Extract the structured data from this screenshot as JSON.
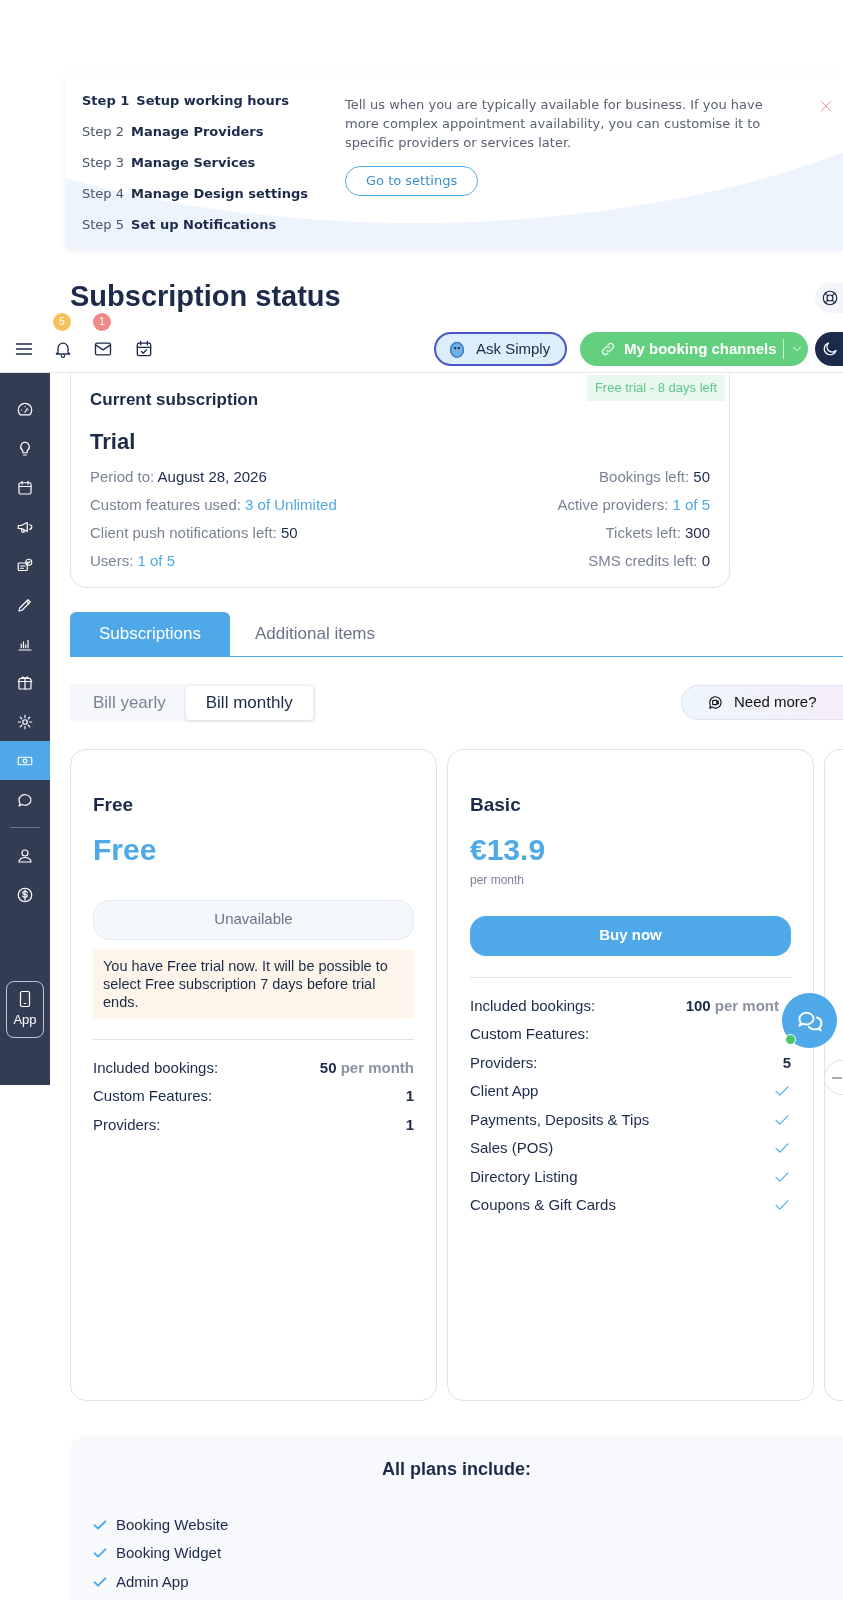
{
  "onboarding": {
    "steps": [
      {
        "label": "Step 1",
        "title": "Setup working hours",
        "selected": true
      },
      {
        "label": "Step 2",
        "title": "Manage Providers",
        "selected": false
      },
      {
        "label": "Step 3",
        "title": "Manage Services",
        "selected": false
      },
      {
        "label": "Step 4",
        "title": "Manage Design settings",
        "selected": false
      },
      {
        "label": "Step 5",
        "title": "Set up Notifications",
        "selected": false
      }
    ],
    "description": "Tell us when you are typically available for business. If you have more complex appointment availability, you can customise it to specific providers or services later.",
    "button": "Go to settings"
  },
  "page_title": "Subscription status",
  "toolbar": {
    "notifications_badge": "5",
    "messages_badge": "1",
    "ask_button": "Ask Simply",
    "channels_button": "My booking channels"
  },
  "sidebar": {
    "items": [
      {
        "kind": "item",
        "selected": false
      },
      {
        "kind": "item",
        "selected": false
      },
      {
        "kind": "item",
        "selected": false
      },
      {
        "kind": "item",
        "selected": false
      },
      {
        "kind": "item",
        "selected": false
      },
      {
        "kind": "item",
        "selected": false
      },
      {
        "kind": "item",
        "selected": false
      },
      {
        "kind": "item",
        "selected": false
      },
      {
        "kind": "item",
        "selected": false
      },
      {
        "kind": "item",
        "selected": true
      },
      {
        "kind": "item",
        "selected": false
      },
      {
        "kind": "divider"
      },
      {
        "kind": "item",
        "selected": false
      },
      {
        "kind": "item",
        "selected": false
      }
    ],
    "app_button": "App"
  },
  "current_subscription": {
    "heading": "Current subscription",
    "badge": "Free trial - 8 days left",
    "plan": "Trial",
    "left": [
      {
        "label": "Period to:",
        "value": "August 28, 2026",
        "kind": "plain"
      },
      {
        "label": "Custom features used:",
        "value": "3 of Unlimited",
        "kind": "link"
      },
      {
        "label": "Client push notifications left:",
        "value": "50",
        "kind": "plain"
      },
      {
        "label": "Users:",
        "value": "1 of 5",
        "kind": "link"
      }
    ],
    "right": [
      {
        "label": "Bookings left:",
        "value": "50",
        "kind": "plain"
      },
      {
        "label": "Active providers:",
        "value": "1 of 5",
        "kind": "link"
      },
      {
        "label": "Tickets left:",
        "value": "300",
        "kind": "plain"
      },
      {
        "label": "SMS credits left:",
        "value": "0",
        "kind": "plain"
      }
    ]
  },
  "tabs": [
    {
      "label": "Subscriptions",
      "selected": true
    },
    {
      "label": "Additional items",
      "selected": false
    }
  ],
  "billing": [
    {
      "label": "Bill yearly",
      "selected": false
    },
    {
      "label": "Bill monthly",
      "selected": true
    }
  ],
  "need_more_button": "Need more?",
  "plans": [
    {
      "name": "Free",
      "price": "Free",
      "action": {
        "label": "Unavailable",
        "disabled": true
      },
      "notice": "You have Free trial now. It will be possible to select Free subscription 7 days before trial ends.",
      "features": [
        {
          "kind": "quantity",
          "label": "Included bookings:",
          "value": "50",
          "unit": "per month"
        },
        {
          "kind": "count",
          "label": "Custom Features:",
          "value": "1"
        },
        {
          "kind": "count",
          "label": "Providers:",
          "value": "1"
        }
      ]
    },
    {
      "name": "Basic",
      "price": "€13.9",
      "period": "per month",
      "action": {
        "label": "Buy now",
        "disabled": false
      },
      "features": [
        {
          "kind": "quantity",
          "label": "Included bookings:",
          "value": "100",
          "unit": "per mont"
        },
        {
          "kind": "count",
          "label": "Custom Features:"
        },
        {
          "kind": "count",
          "label": "Providers:",
          "value": "5"
        },
        {
          "kind": "check",
          "label": "Client App"
        },
        {
          "kind": "check",
          "label": "Payments, Deposits & Tips"
        },
        {
          "kind": "check",
          "label": "Sales (POS)"
        },
        {
          "kind": "check",
          "label": "Directory Listing"
        },
        {
          "kind": "check",
          "label": "Coupons & Gift Cards"
        }
      ]
    }
  ],
  "all_plans": {
    "title": "All plans include:",
    "items": [
      "Booking Website",
      "Booking Widget",
      "Admin App"
    ]
  },
  "chat": {
    "online": true
  }
}
